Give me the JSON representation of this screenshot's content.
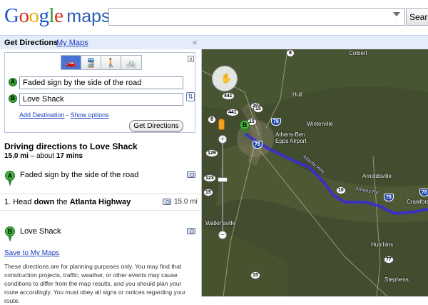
{
  "header": {
    "logo_text": "Google",
    "logo_suffix": "maps",
    "search_value": "",
    "search_button": "Sear"
  },
  "tabs": {
    "directions": "Get Directions",
    "my_maps": "My Maps",
    "collapse": "«"
  },
  "form": {
    "modes": [
      "car-icon",
      "transit-icon",
      "walk-icon",
      "bike-icon"
    ],
    "modes_glyphs": [
      "🚗",
      "🚆",
      "🚶",
      "🚲"
    ],
    "close": "x",
    "marker_a": "A",
    "marker_b": "B",
    "origin": "Faded sign by the side of the road",
    "destination": "Love Shack",
    "swap_glyph": "⇅",
    "add_destination": "Add Destination",
    "separator": " - ",
    "show_options": "Show options",
    "submit": "Get Directions"
  },
  "directions": {
    "title": "Driving directions to Love Shack",
    "distance": "15.0 mi",
    "about": " – about ",
    "time": "17 mins",
    "start_marker": "A",
    "start_label": "Faded sign by the side of the road",
    "step_number": "1. Head ",
    "step_bold1": "down",
    "step_mid": " the ",
    "step_bold2": "Atlanta Highway",
    "step_distance": "15.0 mi",
    "end_marker": "B",
    "end_label": "Love Shack",
    "save_link": "Save to My Maps",
    "disclaimer": "These directions are for planning purposes only. You may find that construction projects, traffic, weather, or other events may cause conditions to differ from the map results, and you should plan your route accordingly. You must obey all signs or notices regarding your route."
  },
  "map": {
    "places": [
      "Colbert",
      "Hull",
      "Winterville",
      "Athens-Ben Epps Airport",
      "Arnoldsville",
      "Crawford",
      "Watkinsville",
      "Hutchins",
      "Stephens"
    ],
    "shields": [
      "8",
      "441",
      "29",
      "8",
      "441",
      "15",
      "78",
      "129",
      "10",
      "78",
      "123",
      "15",
      "77",
      "15",
      "15",
      "78",
      "78"
    ],
    "route_labels": [
      "Atlanta Hwy",
      "Athens Rd"
    ],
    "pin_marker": "B",
    "zoom_plus": "+",
    "zoom_minus": "−"
  },
  "colors": {
    "route": "#3b2ed0",
    "link": "#1a3dc1",
    "marker": "#47b23f"
  }
}
